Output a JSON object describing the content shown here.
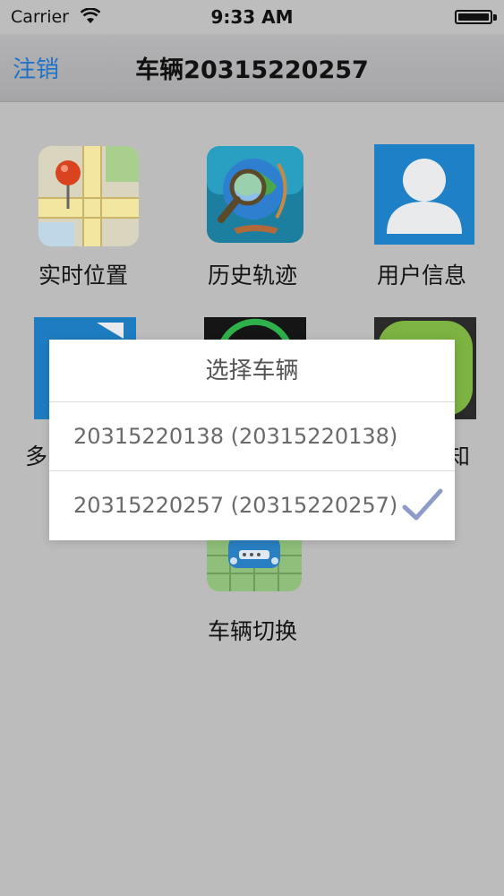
{
  "status_bar": {
    "carrier": "Carrier",
    "time": "9:33 AM",
    "wifi_icon": "wifi-icon",
    "battery_icon": "battery-icon"
  },
  "nav": {
    "logout_label": "注销",
    "title": "车辆20315220257"
  },
  "grid": {
    "items": [
      {
        "label": "实时位置",
        "icon": "map-pin-icon"
      },
      {
        "label": "历史轨迹",
        "icon": "globe-magnifier-icon"
      },
      {
        "label": "用户信息",
        "icon": "user-icon"
      },
      {
        "label": "多",
        "icon": "document-icon"
      },
      {
        "label": "",
        "icon": "radar-icon"
      },
      {
        "label": "知",
        "icon": "green-app-icon"
      },
      {
        "label": "车辆切换",
        "icon": "car-switch-icon"
      }
    ]
  },
  "dialog": {
    "title": "选择车辆",
    "options": [
      {
        "text": "20315220138 (20315220138)",
        "selected": false
      },
      {
        "text": "20315220257 (20315220257)",
        "selected": true
      }
    ],
    "check_icon": "checkmark-icon"
  },
  "colors": {
    "accent": "#1e73c9",
    "background": "#bdbcbd",
    "check": "#8e9bc9"
  }
}
